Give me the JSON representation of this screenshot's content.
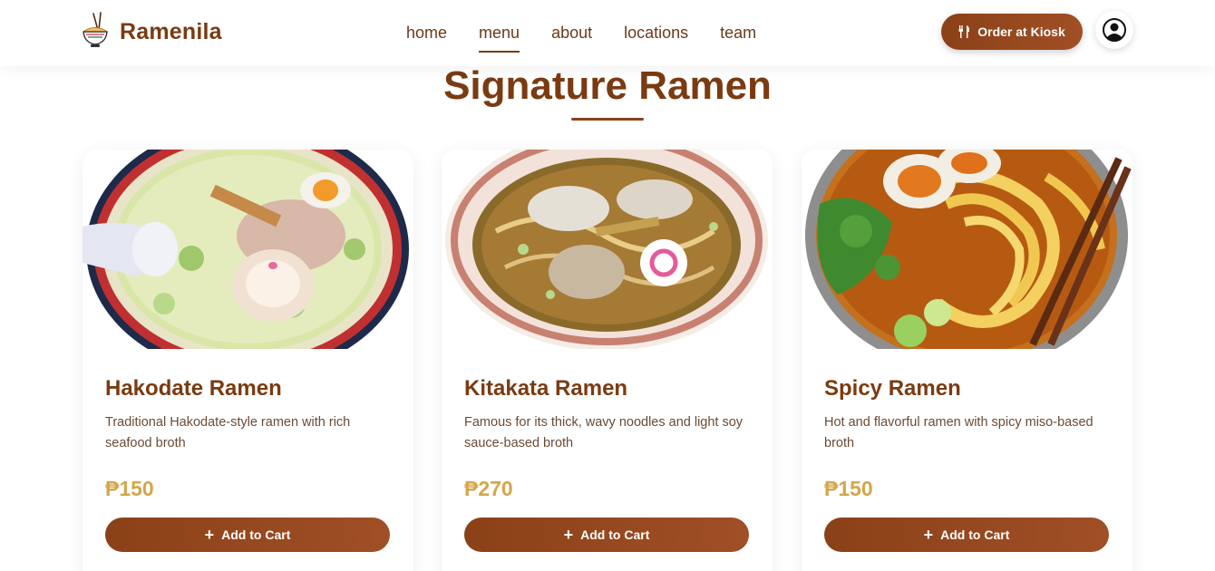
{
  "header": {
    "brand_name": "Ramenila",
    "logo_icon": "ramen-bowl-icon",
    "nav": [
      {
        "label": "home",
        "active": false
      },
      {
        "label": "menu",
        "active": true
      },
      {
        "label": "about",
        "active": false
      },
      {
        "label": "locations",
        "active": false
      },
      {
        "label": "team",
        "active": false
      }
    ],
    "kiosk_button": {
      "label": "Order at Kiosk",
      "icon": "utensils-icon"
    },
    "user_icon": "user-circle-icon"
  },
  "section": {
    "title": "Signature Ramen"
  },
  "cards": [
    {
      "name": "Hakodate Ramen",
      "description": "Traditional Hakodate-style ramen with rich seafood broth",
      "price": "₱150",
      "button_label": "Add to Cart",
      "image": "hakodate-ramen-photo"
    },
    {
      "name": "Kitakata Ramen",
      "description": "Famous for its thick, wavy noodles and light soy sauce-based broth",
      "price": "₱270",
      "button_label": "Add to Cart",
      "image": "kitakata-ramen-photo"
    },
    {
      "name": "Spicy Ramen",
      "description": "Hot and flavorful ramen with spicy miso-based broth",
      "price": "₱150",
      "button_label": "Add to Cart",
      "image": "spicy-ramen-photo"
    }
  ],
  "colors": {
    "brand_brown": "#7a3b12",
    "button_brown": "#8b4117",
    "price_gold": "#d4a64a"
  }
}
